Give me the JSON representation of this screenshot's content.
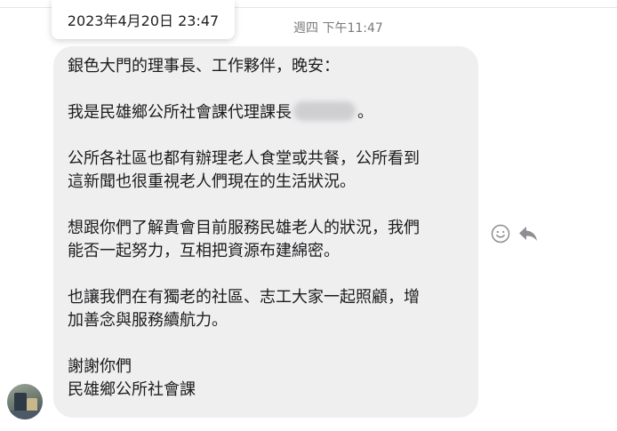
{
  "header": {
    "date_chip": "2023年4月20日 23:47",
    "message_time": "週四 下午11:47"
  },
  "message": {
    "greeting": "銀色大門的理事長、工作夥伴，晚安：",
    "intro_prefix": "我是民雄鄉公所社會課代理課長",
    "intro_suffix": "。",
    "para1_line1": "公所各社區也都有辦理老人食堂或共餐，公所看到",
    "para1_line2": "這新聞也很重視老人們現在的生活狀況。",
    "para2_line1": "想跟你們了解貴會目前服務民雄老人的狀況，我們",
    "para2_line2": "能否一起努力，互相把資源布建綿密。",
    "para3_line1": "也讓我們在有獨老的社區、志工大家一起照顧，增",
    "para3_line2": "加善念與服務續航力。",
    "closing_line1": "謝謝你們",
    "closing_line2": "民雄鄉公所社會課"
  },
  "icons": {
    "react": "smile-icon",
    "reply": "reply-icon",
    "icon_color": "#8e8e93"
  },
  "colors": {
    "bubble": "#efeff0",
    "time_text": "#7a7a7a"
  }
}
